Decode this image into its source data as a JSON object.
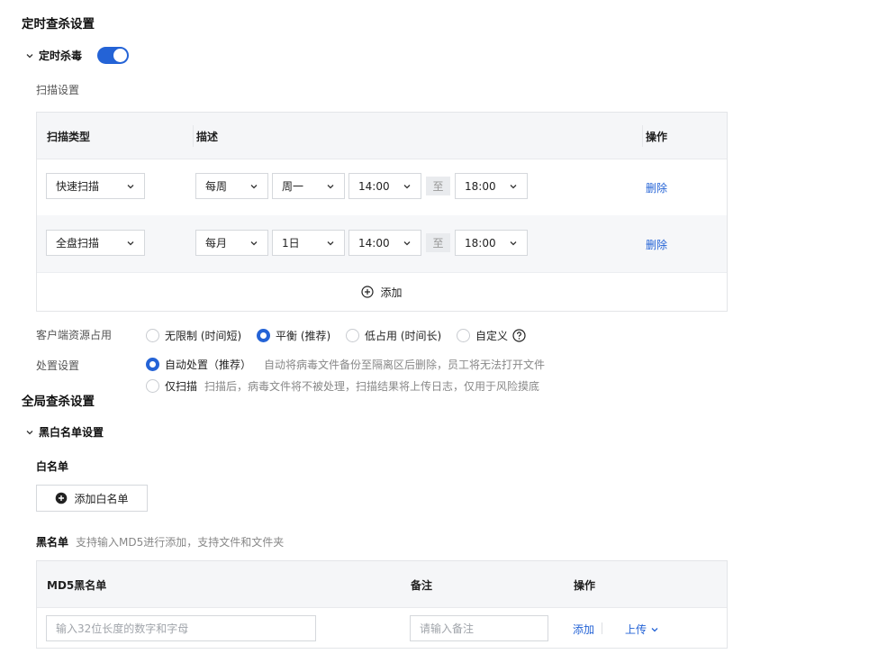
{
  "scheduled": {
    "title": "定时查杀设置",
    "section_label": "定时杀毒",
    "toggle_on": true,
    "scan_settings_label": "扫描设置",
    "table": {
      "headers": [
        "扫描类型",
        "描述",
        "操作"
      ],
      "rows": [
        {
          "type": "快速扫描",
          "freq": "每周",
          "day": "周一",
          "start": "14:00",
          "to": "至",
          "end": "18:00",
          "action": "删除"
        },
        {
          "type": "全盘扫描",
          "freq": "每月",
          "day": "1日",
          "start": "14:00",
          "to": "至",
          "end": "18:00",
          "action": "删除"
        }
      ],
      "add_label": "添加"
    },
    "resource": {
      "label": "客户端资源占用",
      "options": [
        "无限制 (时间短)",
        "平衡 (推荐)",
        "低占用 (时间长)",
        "自定义"
      ],
      "selected": 1
    },
    "disposal": {
      "label": "处置设置",
      "options": [
        {
          "label": "自动处置（推荐）",
          "desc": "自动将病毒文件备份至隔离区后删除，员工将无法打开文件"
        },
        {
          "label": "仅扫描",
          "desc": "扫描后，病毒文件将不被处理，扫描结果将上传日志，仅用于风险摸底"
        }
      ],
      "selected": 0
    }
  },
  "global": {
    "title": "全局查杀设置",
    "section_label": "黑白名单设置",
    "whitelist": {
      "label": "白名单",
      "add_button": "添加白名单"
    },
    "blacklist": {
      "label": "黑名单",
      "hint": "支持输入MD5进行添加，支持文件和文件夹",
      "headers": [
        "MD5黑名单",
        "备注",
        "操作"
      ],
      "md5_placeholder": "输入32位长度的数字和字母",
      "note_placeholder": "请输入备注",
      "add_action": "添加",
      "upload_action": "上传"
    }
  },
  "colors": {
    "accent": "#2463d6",
    "header_bg": "#f5f6f8",
    "row_alt_bg": "#f6f7f9"
  }
}
